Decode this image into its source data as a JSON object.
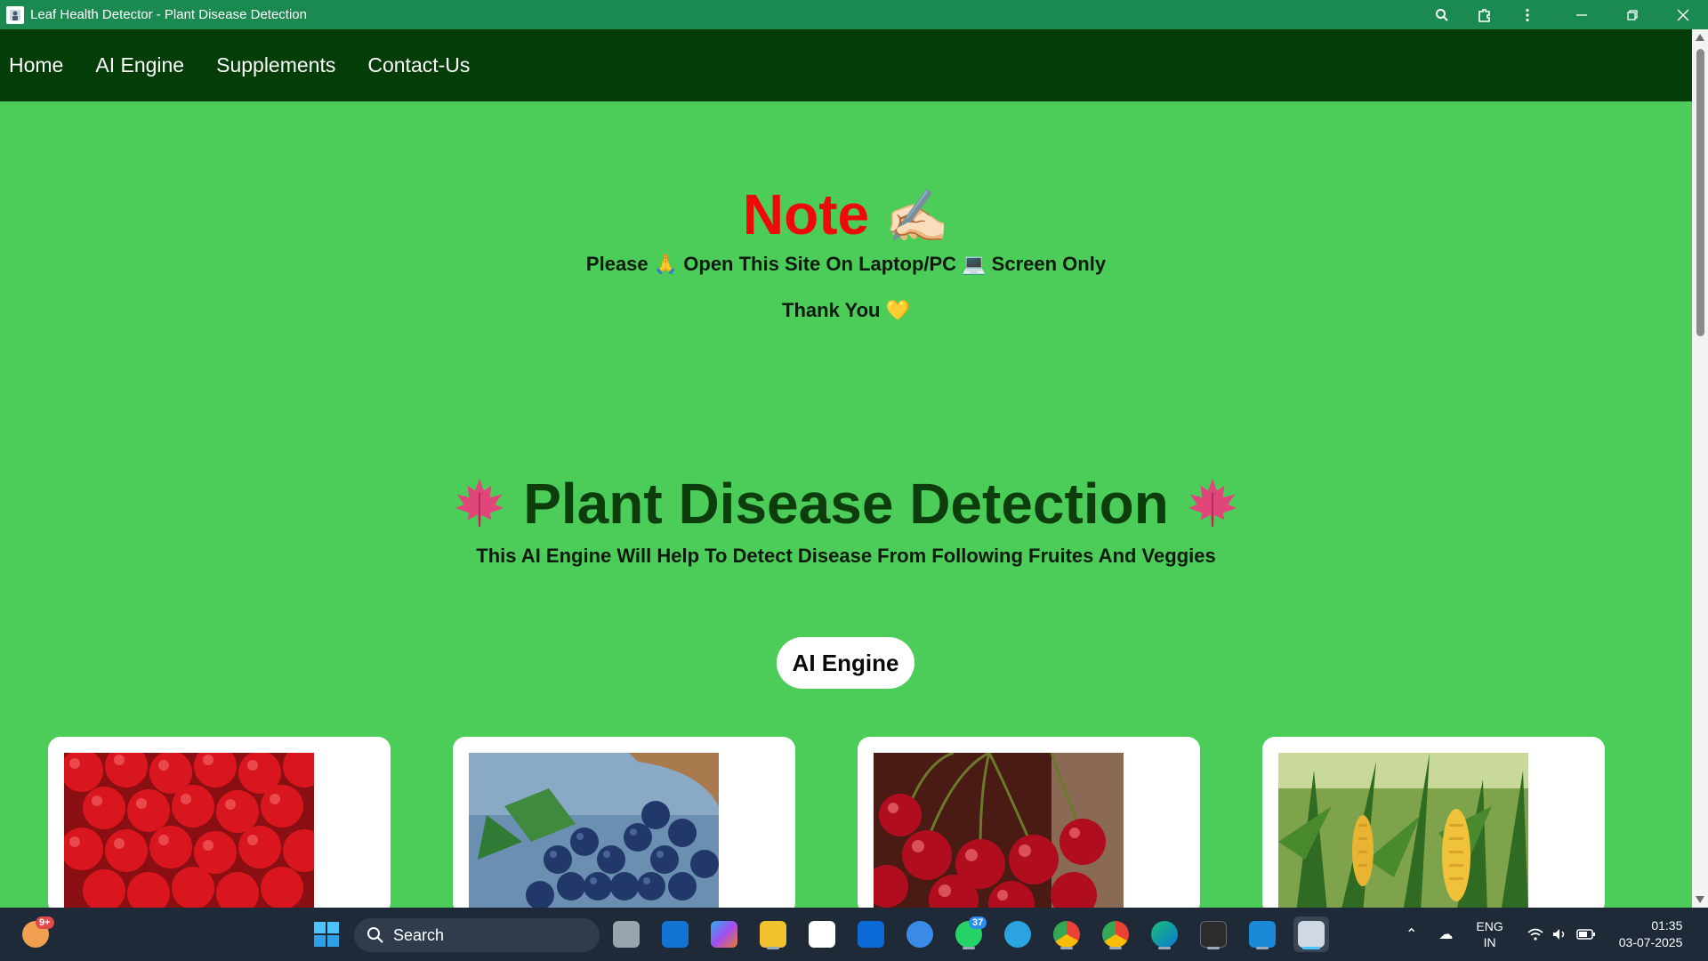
{
  "window": {
    "title": "Leaf Health Detector - Plant Disease Detection"
  },
  "nav": {
    "items": [
      "Home",
      "AI Engine",
      "Supplements",
      "Contact-Us"
    ]
  },
  "note": {
    "title": "Note",
    "title_emoji": "✍🏻",
    "line1": "Please 🙏 Open This Site On Laptop/PC 💻 Screen Only",
    "line2": "Thank You 💛"
  },
  "hero": {
    "title": "Plant Disease Detection",
    "subtitle": "This AI Engine Will Help To Detect Disease From Following Fruites And Veggies",
    "button_label": "AI Engine"
  },
  "cards": [
    {
      "image": "apples-image"
    },
    {
      "image": "blueberries-image"
    },
    {
      "image": "cherries-image"
    },
    {
      "image": "corn-image"
    }
  ],
  "taskbar": {
    "search_placeholder": "Search",
    "notification_badge": "9+",
    "whatsapp_badge": "37",
    "language": "ENG",
    "region": "IN",
    "time": "01:35",
    "date": "03-07-2025"
  },
  "colors": {
    "titlebar": "#1b8a51",
    "navbar": "#043d08",
    "page_bg": "#4ccd5a",
    "note_red": "#ef0a0a",
    "title_green": "#0d3d0d"
  }
}
